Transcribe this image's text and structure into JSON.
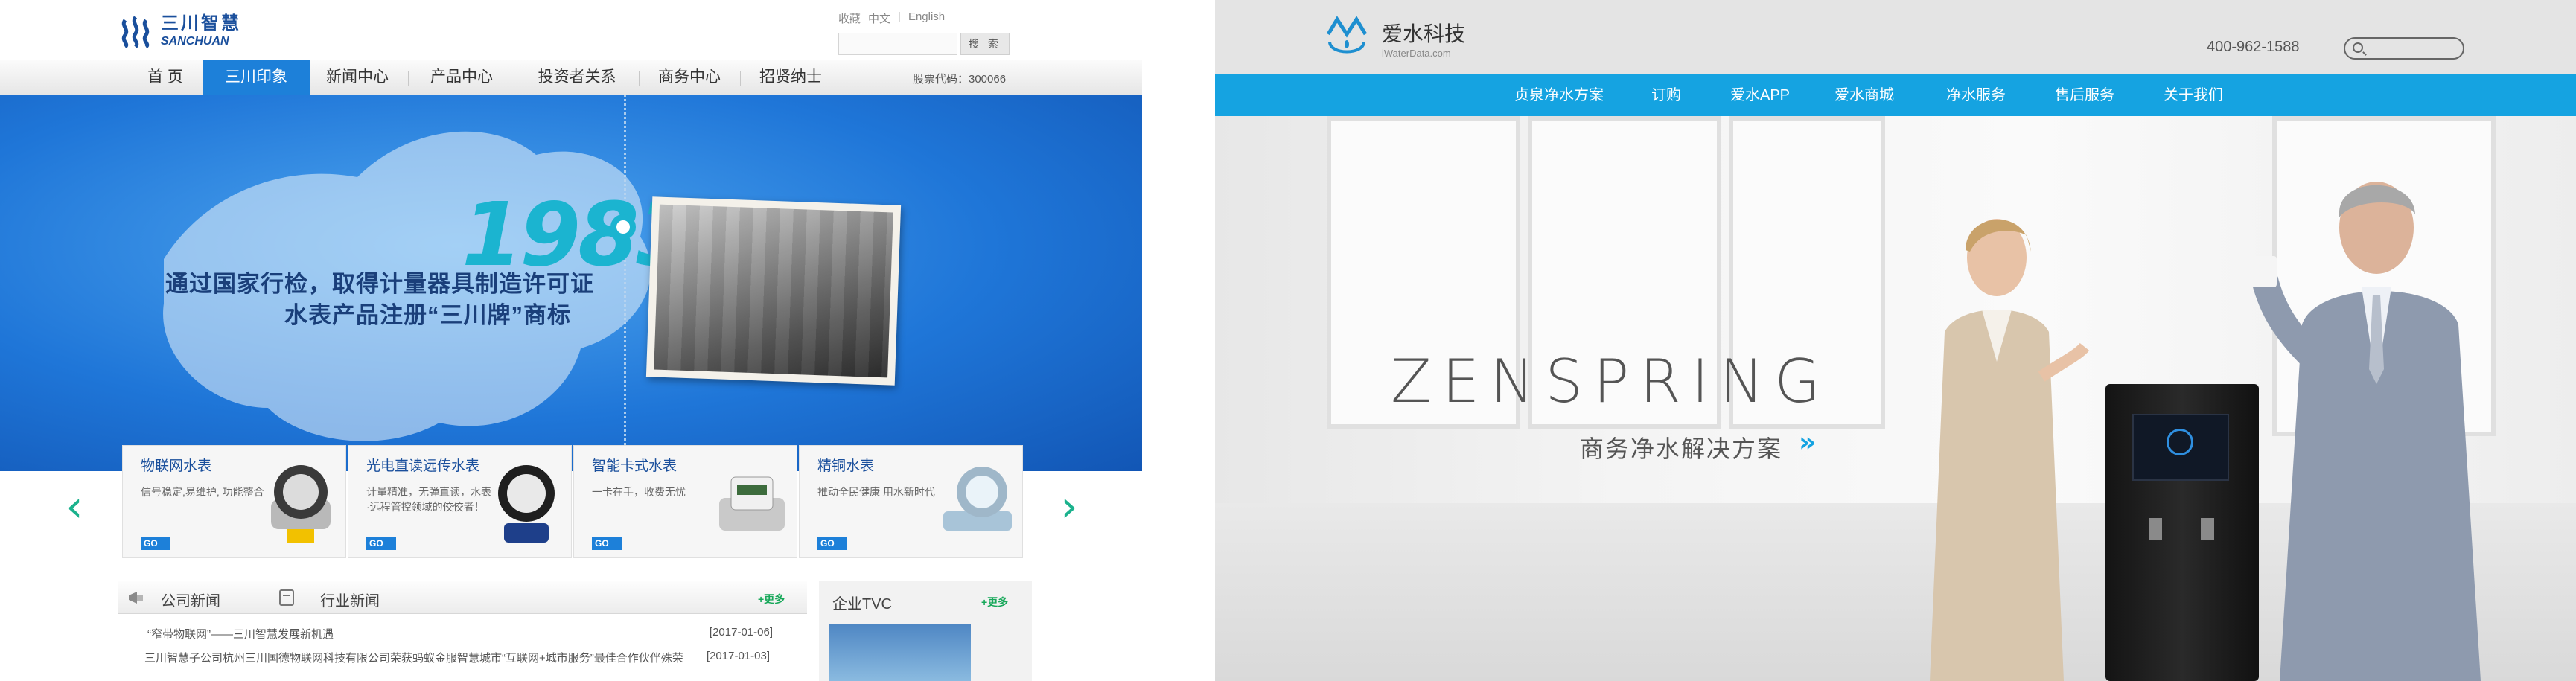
{
  "left_site": {
    "logo": {
      "cn": "三川智慧",
      "en": "SANCHUAN"
    },
    "toplinks": [
      "收藏",
      "中文",
      "English"
    ],
    "search": {
      "placeholder": "",
      "button": "搜 索"
    },
    "nav": [
      "首 页",
      "三川印象",
      "新闻中心",
      "产品中心",
      "投资者关系",
      "商务中心",
      "招贤纳士"
    ],
    "nav_active_index": 1,
    "stock_code": "股票代码：300066",
    "hero": {
      "year": "1983",
      "slogan_line1": "通过国家行检，取得计量器具制造许可证",
      "slogan_line2": "水表产品注册“三川牌”商标"
    },
    "products": [
      {
        "title": "物联网水表",
        "desc": "信号稳定,易维护, 功能整合",
        "go": "GO"
      },
      {
        "title": "光电直读远传水表",
        "desc": "计量精准，无弹直读，水表·远程管控领域的佼佼者！",
        "go": "GO"
      },
      {
        "title": "智能卡式水表",
        "desc": "一卡在手，收费无忧",
        "go": "GO"
      },
      {
        "title": "精铜水表",
        "desc": "推动全民健康 用水新时代",
        "go": "GO"
      }
    ],
    "news": {
      "tabs": [
        "公司新闻",
        "行业新闻"
      ],
      "more": "+更多",
      "items": [
        {
          "title": "“窄带物联网”——三川智慧发展新机遇",
          "date": "[2017-01-06]"
        },
        {
          "title": "三川智慧子公司杭州三川国德物联网科技有限公司荣获蚂蚁金服智慧城市“互联网+城市服务”最佳合作伙伴殊荣",
          "date": "[2017-01-03]"
        }
      ]
    },
    "tvc": {
      "title": "企业TVC",
      "more": "+更多"
    },
    "accent": "#1d80d9"
  },
  "right_site": {
    "logo": {
      "cn": "爱水科技",
      "en": "iWaterData.com",
      "mark": "iWaterData"
    },
    "phone": "400-962-1588",
    "search": {
      "placeholder": ""
    },
    "nav": [
      "贞泉净水方案",
      "订购",
      "爱水APP",
      "爱水商城",
      "净水服务",
      "售后服务",
      "关于我们"
    ],
    "hero": {
      "title": "ZENSPRING",
      "subtitle": "商务净水解决方案",
      "arrow": "»"
    },
    "accent": "#15a3e1"
  }
}
